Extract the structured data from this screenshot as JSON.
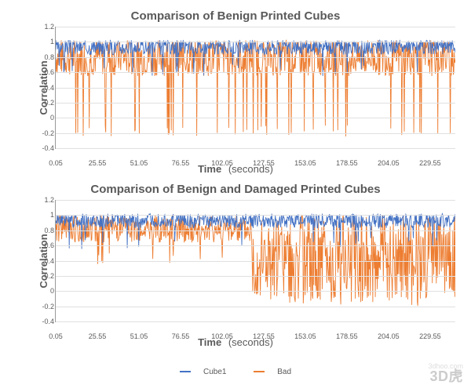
{
  "chart_data": [
    {
      "type": "line",
      "title": "Comparison of Benign Printed Cubes",
      "xlabel": "Time",
      "xunit": "(seconds)",
      "ylabel": "Correlation",
      "ylim": [
        -0.4,
        1.2
      ],
      "xlim": [
        0.05,
        245
      ],
      "y_ticks": [
        -0.4,
        -0.2,
        0,
        0.2,
        0.4,
        0.6,
        0.8,
        1,
        1.2
      ],
      "x_ticks": [
        0.05,
        25.55,
        51.05,
        76.55,
        102.05,
        127.55,
        153.05,
        178.55,
        204.05,
        229.55
      ],
      "series": [
        {
          "name": "Cube1",
          "color": "#4472c4"
        },
        {
          "name": "Bad",
          "color": "#ed7d31"
        }
      ],
      "notes": "Both series oscillate densely between ~0.3 and 1.0 with occasional Bad spikes down to ~-0.3 across the full time range."
    },
    {
      "type": "line",
      "title": "Comparison of Benign and Damaged Printed Cubes",
      "xlabel": "Time",
      "xunit": "(seconds)",
      "ylabel": "Correlation",
      "ylim": [
        -0.4,
        1.2
      ],
      "xlim": [
        0.05,
        245
      ],
      "y_ticks": [
        -0.4,
        -0.2,
        0,
        0.2,
        0.4,
        0.6,
        0.8,
        1,
        1.2
      ],
      "x_ticks": [
        0.05,
        25.55,
        51.05,
        76.55,
        102.05,
        127.55,
        153.05,
        178.55,
        204.05,
        229.55
      ],
      "series": [
        {
          "name": "Cube1",
          "color": "#4472c4"
        },
        {
          "name": "Bad",
          "color": "#ed7d31"
        }
      ],
      "notes": "Both track ~0.6–1.0 until ~125 s; after ~125 s the Bad series diverges with large oscillations between ~-0.2 and 1.0 while Cube1 stays near 0.7–1.0."
    }
  ],
  "legend": {
    "items": [
      {
        "label": "Cube1",
        "color": "#4472c4"
      },
      {
        "label": "Bad",
        "color": "#ed7d31"
      }
    ]
  },
  "watermark": {
    "brand": "3D虎",
    "url": "3dhoo.com"
  }
}
